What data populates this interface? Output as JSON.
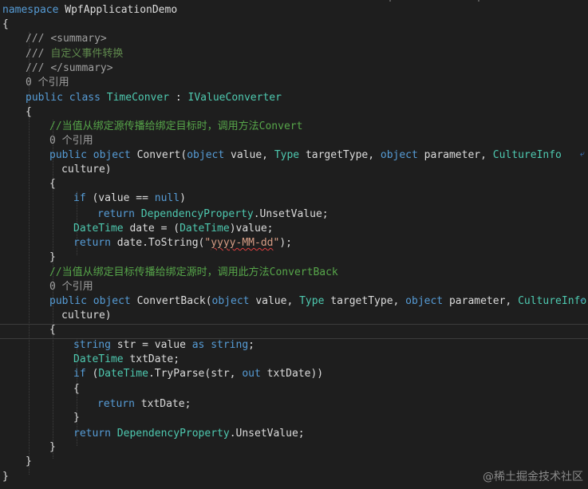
{
  "code": {
    "ns_kw": "namespace",
    "ns_name": "WpfApplicationDemo",
    "open_brace": "{",
    "close_brace": "}",
    "doc_prefix": "///",
    "summary_open": "<summary>",
    "summary_text": "自定义事件转换",
    "summary_close": "</summary>",
    "ref_count": "0 个引用",
    "kw_public": "public",
    "kw_class": "class",
    "class_name": "TimeConver",
    "colon": ":",
    "iface": "IValueConverter",
    "comment_convert": "//当值从绑定源传播给绑定目标时，调用方法Convert",
    "kw_object": "object",
    "m_convert": "Convert",
    "param_value": "value,",
    "type_Type": "Type",
    "param_targetType": "targetType,",
    "param_parameter": "parameter,",
    "type_CultureInfo": "CultureInfo",
    "param_culture": "culture)",
    "kw_if": "if",
    "cond_null_a": "(value ==",
    "kw_null": "null",
    "cond_null_b": ")",
    "kw_return": "return",
    "type_DepProp": "DependencyProperty",
    "unset": ".UnsetValue;",
    "type_DateTime": "DateTime",
    "date_decl": "date = (",
    "date_cast_end": ")value;",
    "tostring_a": "date.ToString(",
    "str_quote_open": "\"",
    "str_fmt": "yyyy-MM-dd",
    "str_quote_close": "\"",
    "tostring_end": ");",
    "comment_back": "//当值从绑定目标传播给绑定源时，调用此方法ConvertBack",
    "m_convertback": "ConvertBack",
    "kw_string": "string",
    "str_decl": "str = value",
    "kw_as": "as",
    "semicolon": ";",
    "txt_decl": "txtDate;",
    "tryparse_a": ".TryParse(str,",
    "kw_out": "out",
    "tryparse_b": "txtDate))",
    "return_txt": "txtDate;",
    "wrap_glyph": "⤶"
  },
  "watermark": "@稀土掘金技术社区"
}
